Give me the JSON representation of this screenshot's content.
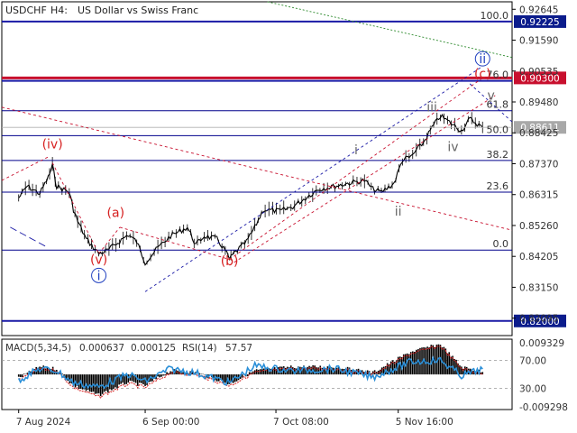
{
  "header": {
    "symbol": "USDCHF",
    "timeframe": "H4:",
    "description": "US Dollar vs Swiss Franc"
  },
  "colors": {
    "blue_line": "#1a1aa6",
    "red_line": "#c8102e",
    "fib_line": "#00008b",
    "wave_red": "#d62020",
    "wave_blue": "#1f3fbf",
    "wave_gray": "#666666",
    "macd_black": "#000000",
    "macd_signal": "#d62020",
    "rsi": "#2a8fd8",
    "price_tag_dark": "#0b1c8c",
    "price_tag_red": "#c8102e",
    "price_tag_gray": "#a8a8a8"
  },
  "chart_data": [
    {
      "type": "line",
      "subtype": "candlestick price chart",
      "title": "USDCHF, H4: US Dollar vs Swiss Franc",
      "x_ticks": [
        "7 Aug 2024",
        "6 Sep 00:00",
        "7 Oct 08:00",
        "5 Nov 16:00"
      ],
      "y_ticks": [
        "0.92645",
        "0.91590",
        "0.90535",
        "0.89480",
        "0.88425",
        "0.87370",
        "0.86315",
        "0.85260",
        "0.84205",
        "0.83150",
        "0.82095"
      ],
      "ylim": [
        0.815,
        0.929
      ],
      "price_series": [
        {
          "x": "2024-08-07",
          "y": 0.862
        },
        {
          "x": "2024-08-09",
          "y": 0.866
        },
        {
          "x": "2024-08-12",
          "y": 0.8635
        },
        {
          "x": "2024-08-14",
          "y": 0.869
        },
        {
          "x": "2024-08-15",
          "y": 0.873
        },
        {
          "x": "2024-08-16",
          "y": 0.866
        },
        {
          "x": "2024-08-19",
          "y": 0.864
        },
        {
          "x": "2024-08-20",
          "y": 0.858
        },
        {
          "x": "2024-08-21",
          "y": 0.854
        },
        {
          "x": "2024-08-23",
          "y": 0.848
        },
        {
          "x": "2024-08-26",
          "y": 0.843
        },
        {
          "x": "2024-08-28",
          "y": 0.844
        },
        {
          "x": "2024-09-02",
          "y": 0.8495
        },
        {
          "x": "2024-09-04",
          "y": 0.847
        },
        {
          "x": "2024-09-06",
          "y": 0.84
        },
        {
          "x": "2024-09-09",
          "y": 0.845
        },
        {
          "x": "2024-09-12",
          "y": 0.849
        },
        {
          "x": "2024-09-16",
          "y": 0.852
        },
        {
          "x": "2024-09-18",
          "y": 0.846
        },
        {
          "x": "2024-09-20",
          "y": 0.849
        },
        {
          "x": "2024-09-23",
          "y": 0.848
        },
        {
          "x": "2024-09-25",
          "y": 0.844
        },
        {
          "x": "2024-09-26",
          "y": 0.841
        },
        {
          "x": "2024-09-27",
          "y": 0.843
        },
        {
          "x": "2024-09-30",
          "y": 0.847
        },
        {
          "x": "2024-10-02",
          "y": 0.852
        },
        {
          "x": "2024-10-04",
          "y": 0.858
        },
        {
          "x": "2024-10-08",
          "y": 0.8575
        },
        {
          "x": "2024-10-11",
          "y": 0.859
        },
        {
          "x": "2024-10-14",
          "y": 0.862
        },
        {
          "x": "2024-10-17",
          "y": 0.865
        },
        {
          "x": "2024-10-21",
          "y": 0.866
        },
        {
          "x": "2024-10-24",
          "y": 0.867
        },
        {
          "x": "2024-10-28",
          "y": 0.868
        },
        {
          "x": "2024-10-30",
          "y": 0.865
        },
        {
          "x": "2024-11-01",
          "y": 0.864
        },
        {
          "x": "2024-11-04",
          "y": 0.867
        },
        {
          "x": "2024-11-06",
          "y": 0.875
        },
        {
          "x": "2024-11-08",
          "y": 0.876
        },
        {
          "x": "2024-11-11",
          "y": 0.881
        },
        {
          "x": "2024-11-13",
          "y": 0.886
        },
        {
          "x": "2024-11-15",
          "y": 0.89
        },
        {
          "x": "2024-11-18",
          "y": 0.887
        },
        {
          "x": "2024-11-20",
          "y": 0.885
        },
        {
          "x": "2024-11-22",
          "y": 0.889
        },
        {
          "x": "2024-11-25",
          "y": 0.8861
        }
      ],
      "horizontal_levels": [
        {
          "price": 0.92225,
          "label": "0.92225",
          "color": "blue_line",
          "fib": "100.0"
        },
        {
          "price": 0.903,
          "label": "0.90300",
          "color": "red_line",
          "fib": ""
        },
        {
          "price": 0.902,
          "label": "",
          "color": "blue_line",
          "fib": "76.0"
        },
        {
          "price": 0.8918,
          "label": "",
          "color": "fib_line",
          "fib": "61.8"
        },
        {
          "price": 0.88611,
          "label": "0.88611",
          "color": "price_tag_gray",
          "fib": ""
        },
        {
          "price": 0.8833,
          "label": "",
          "color": "fib_line",
          "fib": "50.0"
        },
        {
          "price": 0.8748,
          "label": "",
          "color": "fib_line",
          "fib": "38.2"
        },
        {
          "price": 0.864,
          "label": "",
          "color": "fib_line",
          "fib": "23.6"
        },
        {
          "price": 0.8442,
          "label": "",
          "color": "fib_line",
          "fib": "0.0"
        },
        {
          "price": 0.82,
          "label": "0.82000",
          "color": "blue_line",
          "fib": ""
        }
      ],
      "wave_labels": [
        {
          "text": "(iv)",
          "x": "2024-08-15",
          "y": 0.879,
          "color": "wave_red",
          "circled": false
        },
        {
          "text": "(a)",
          "x": "2024-08-30",
          "y": 0.8555,
          "color": "wave_red",
          "circled": false
        },
        {
          "text": "(v)",
          "x": "2024-08-26",
          "y": 0.8395,
          "color": "wave_red",
          "circled": false
        },
        {
          "text": "i",
          "x": "2024-08-26",
          "y": 0.834,
          "color": "wave_blue",
          "circled": true
        },
        {
          "text": "(b)",
          "x": "2024-09-26",
          "y": 0.839,
          "color": "wave_red",
          "circled": false
        },
        {
          "text": "i",
          "x": "2024-10-26",
          "y": 0.877,
          "color": "wave_gray",
          "circled": false
        },
        {
          "text": "ii",
          "x": "2024-11-05",
          "y": 0.856,
          "color": "wave_gray",
          "circled": false
        },
        {
          "text": "iii",
          "x": "2024-11-13",
          "y": 0.8915,
          "color": "wave_gray",
          "circled": false
        },
        {
          "text": "iv",
          "x": "2024-11-18",
          "y": 0.878,
          "color": "wave_gray",
          "circled": false
        },
        {
          "text": "v",
          "x": "2024-11-27",
          "y": 0.8955,
          "color": "wave_gray",
          "circled": false
        },
        {
          "text": "(c)",
          "x": "2024-11-25",
          "y": 0.903,
          "color": "wave_red",
          "circled": false
        },
        {
          "text": "ii",
          "x": "2024-11-25",
          "y": 0.908,
          "color": "wave_blue",
          "circled": true
        }
      ]
    },
    {
      "type": "line",
      "subtype": "oscillator panel",
      "title": "MACD(5,34,5) 0.000637 0.000125 RSI(14) 57.57",
      "macd_params": "MACD(5,34,5)",
      "macd_value": 0.000637,
      "signal_value": 0.000125,
      "rsi_params": "RSI(14)",
      "rsi_value": 57.57,
      "y_ticks": [
        "0.009329",
        "70.00",
        "30.00",
        "-0.009298"
      ],
      "macd_series": [
        {
          "x": "2024-08-07",
          "y": -0.001
        },
        {
          "x": "2024-08-12",
          "y": 0.002
        },
        {
          "x": "2024-08-16",
          "y": 0.0015
        },
        {
          "x": "2024-08-20",
          "y": -0.003
        },
        {
          "x": "2024-08-26",
          "y": -0.0055
        },
        {
          "x": "2024-09-02",
          "y": -0.002
        },
        {
          "x": "2024-09-06",
          "y": -0.003
        },
        {
          "x": "2024-09-12",
          "y": 0.001
        },
        {
          "x": "2024-09-18",
          "y": 0.0005
        },
        {
          "x": "2024-09-26",
          "y": -0.0025
        },
        {
          "x": "2024-10-02",
          "y": 0.001
        },
        {
          "x": "2024-10-11",
          "y": 0.002
        },
        {
          "x": "2024-10-21",
          "y": 0.002
        },
        {
          "x": "2024-10-30",
          "y": 0.0005
        },
        {
          "x": "2024-11-08",
          "y": 0.006
        },
        {
          "x": "2024-11-15",
          "y": 0.008
        },
        {
          "x": "2024-11-20",
          "y": 0.002
        },
        {
          "x": "2024-11-25",
          "y": 0.000637
        }
      ],
      "rsi_series": [
        {
          "x": "2024-08-07",
          "y": 42
        },
        {
          "x": "2024-08-12",
          "y": 58
        },
        {
          "x": "2024-08-16",
          "y": 55
        },
        {
          "x": "2024-08-20",
          "y": 38
        },
        {
          "x": "2024-08-26",
          "y": 32
        },
        {
          "x": "2024-09-02",
          "y": 50
        },
        {
          "x": "2024-09-06",
          "y": 40
        },
        {
          "x": "2024-09-12",
          "y": 58
        },
        {
          "x": "2024-09-18",
          "y": 52
        },
        {
          "x": "2024-09-26",
          "y": 38
        },
        {
          "x": "2024-10-02",
          "y": 62
        },
        {
          "x": "2024-10-11",
          "y": 55
        },
        {
          "x": "2024-10-21",
          "y": 58
        },
        {
          "x": "2024-10-30",
          "y": 46
        },
        {
          "x": "2024-11-08",
          "y": 68
        },
        {
          "x": "2024-11-15",
          "y": 70
        },
        {
          "x": "2024-11-20",
          "y": 48
        },
        {
          "x": "2024-11-25",
          "y": 57.57
        }
      ]
    }
  ]
}
